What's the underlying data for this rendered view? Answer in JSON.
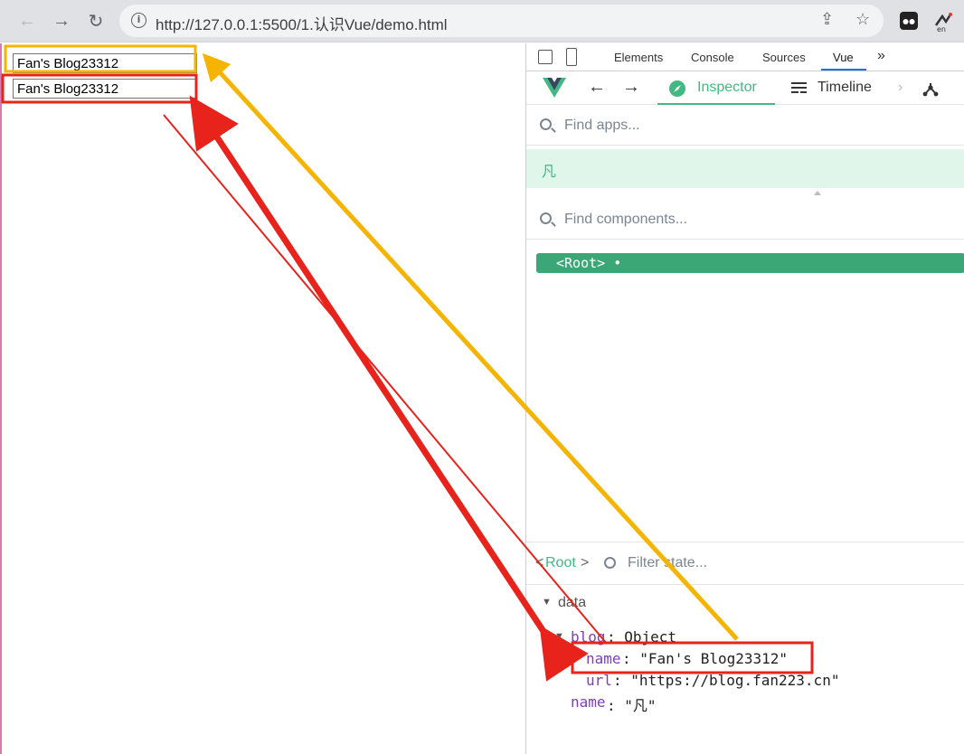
{
  "browser": {
    "url": "http://127.0.0.1:5500/1.认识Vue/demo.html",
    "back_icon": "arrow-left-icon",
    "forward_icon": "arrow-right-icon",
    "reload_icon": "reload-icon"
  },
  "page": {
    "input_top_value": "Fan's Blog23312",
    "input_bottom_value": "Fan's Blog23312"
  },
  "devtools": {
    "tabs": [
      "Elements",
      "Console",
      "Sources",
      "Vue"
    ],
    "more_tabs": "»",
    "vue_tabs": {
      "inspector": "Inspector",
      "timeline": "Timeline"
    },
    "find_apps_placeholder": "Find apps...",
    "app_name": "凡",
    "find_components_placeholder": "Find components...",
    "component_root": "<Root> •",
    "state_title_prefix": "<",
    "state_title_name": "Root",
    "state_title_suffix": ">",
    "filter_placeholder": "Filter state...",
    "data_label": "data",
    "blog_key": "blog",
    "blog_type": ": Object",
    "name_key": "name",
    "name_value": ": \"Fan's Blog23312\"",
    "url_key": "url",
    "url_value": ": \"https://blog.fan223.cn\"",
    "name2_key": "name",
    "name2_value": ": \"凡\""
  },
  "colors": {
    "vue_green": "#42b883",
    "highlight_red": "#e8231c",
    "highlight_yellow": "#f4b400"
  }
}
